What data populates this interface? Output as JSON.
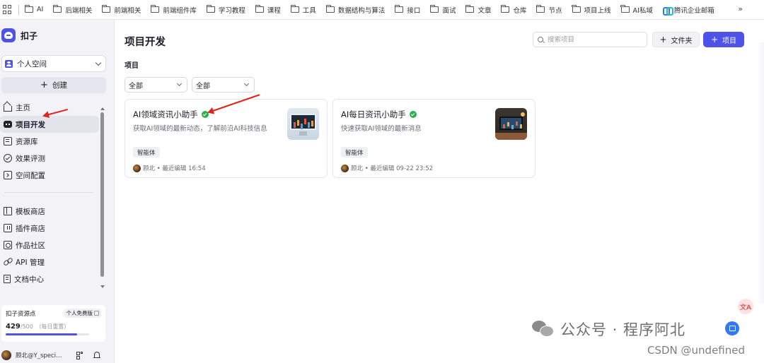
{
  "bookmarks": {
    "items": [
      "AI",
      "后端相关",
      "前端相关",
      "前端组件库",
      "学习教程",
      "课程",
      "工具",
      "数据结构与算法",
      "接口",
      "面试",
      "文章",
      "仓库",
      "节点",
      "项目上线",
      "AI私域"
    ],
    "special": "腾讯企业邮箱",
    "more": "»"
  },
  "sidebar": {
    "brand": "扣子",
    "space": "个人空间",
    "create": "创建",
    "nav_primary": [
      "主页",
      "项目开发",
      "资源库",
      "效果评测",
      "空间配置"
    ],
    "nav_secondary": [
      "模板商店",
      "插件商店",
      "作品社区",
      "API 管理",
      "文档中心"
    ],
    "points": {
      "title": "扣子资源点",
      "plan": "个人免费版",
      "used": "429",
      "total": "/500",
      "reset": "（每日重置）",
      "fraction": 0.858
    },
    "user": "顾北@Y_speci…"
  },
  "main": {
    "title": "项目开发",
    "search_placeholder": "搜索项目",
    "folder_button": "文件夹",
    "project_button": "项目",
    "section": "项目",
    "filters": [
      "全部",
      "全部"
    ],
    "cards": [
      {
        "title": "AI领域资讯小助手",
        "desc": "获取AI领域的最新动态，了解前沿AI科技信息",
        "tag": "智能体",
        "meta": "顾北 • 最近编辑 16:54"
      },
      {
        "title": "AI每日资讯小助手",
        "desc": "快速获取AI领域的最新消息",
        "tag": "智能体",
        "meta": "顾北 • 最近编辑 09-22 23:52"
      }
    ]
  },
  "watermark": {
    "wechat": "公众号 · 程序阿北",
    "csdn": "CSDN @undefined"
  },
  "colors": {
    "accent": "#4d53e8",
    "verified": "#2db04f",
    "annotation": "#e0241c"
  }
}
